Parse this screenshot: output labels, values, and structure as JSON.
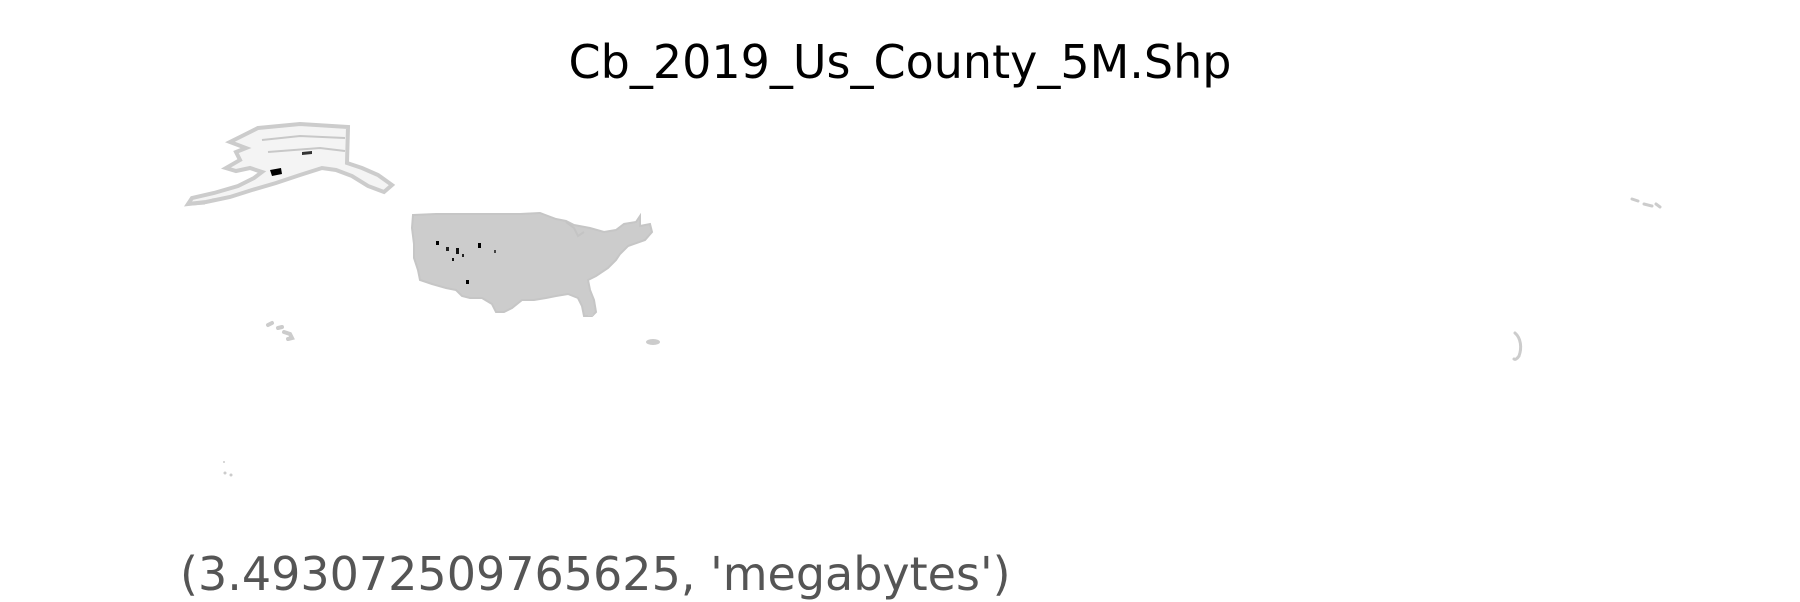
{
  "map": {
    "title": "Cb_2019_Us_County_5M.Shp",
    "colors": {
      "land": "#cccccc",
      "land_outline": "#c6c6c6",
      "alaska_fill": "#f4f4f4",
      "alaska_border": "#bdbdbd",
      "highlight": "#000000",
      "background": "#ffffff"
    },
    "regions": [
      "contiguous-us",
      "alaska",
      "hawaii",
      "puerto-rico",
      "guam",
      "northern-mariana-islands",
      "american-samoa"
    ]
  },
  "output": {
    "size_text": "(3.493072509765625, 'megabytes')"
  }
}
